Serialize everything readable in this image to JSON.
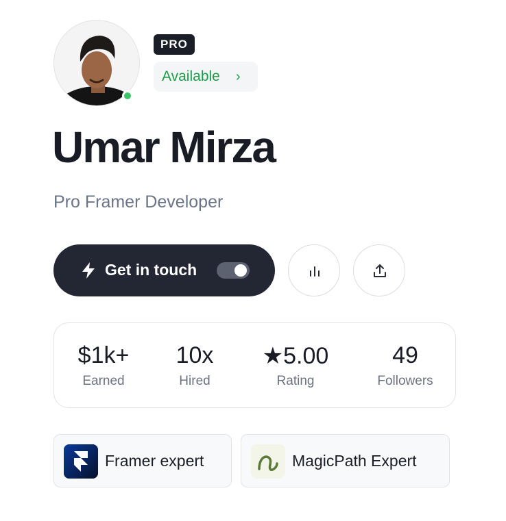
{
  "profile": {
    "badge": "PRO",
    "availability": "Available",
    "availability_chevron": "›",
    "name": "Umar Mirza",
    "title": "Pro Framer Developer",
    "online_color": "#3cc466"
  },
  "actions": {
    "cta_label": "Get in touch",
    "cta_icon": "lightning-bolt-icon",
    "toggle_on": true,
    "stats_icon": "bar-chart-icon",
    "share_icon": "share-upload-icon"
  },
  "stats": [
    {
      "value": "$1k+",
      "label": "Earned"
    },
    {
      "value": "10x",
      "label": "Hired"
    },
    {
      "value": "★5.00",
      "label": "Rating"
    },
    {
      "value": "49",
      "label": "Followers"
    }
  ],
  "badges": [
    {
      "label": "Framer expert",
      "icon": "framer-logo-icon"
    },
    {
      "label": "MagicPath Expert",
      "icon": "magicpath-logo-icon"
    }
  ],
  "colors": {
    "accent_dark": "#232734",
    "available_green": "#1d9e46",
    "subtitle_gray": "#6c7488"
  }
}
